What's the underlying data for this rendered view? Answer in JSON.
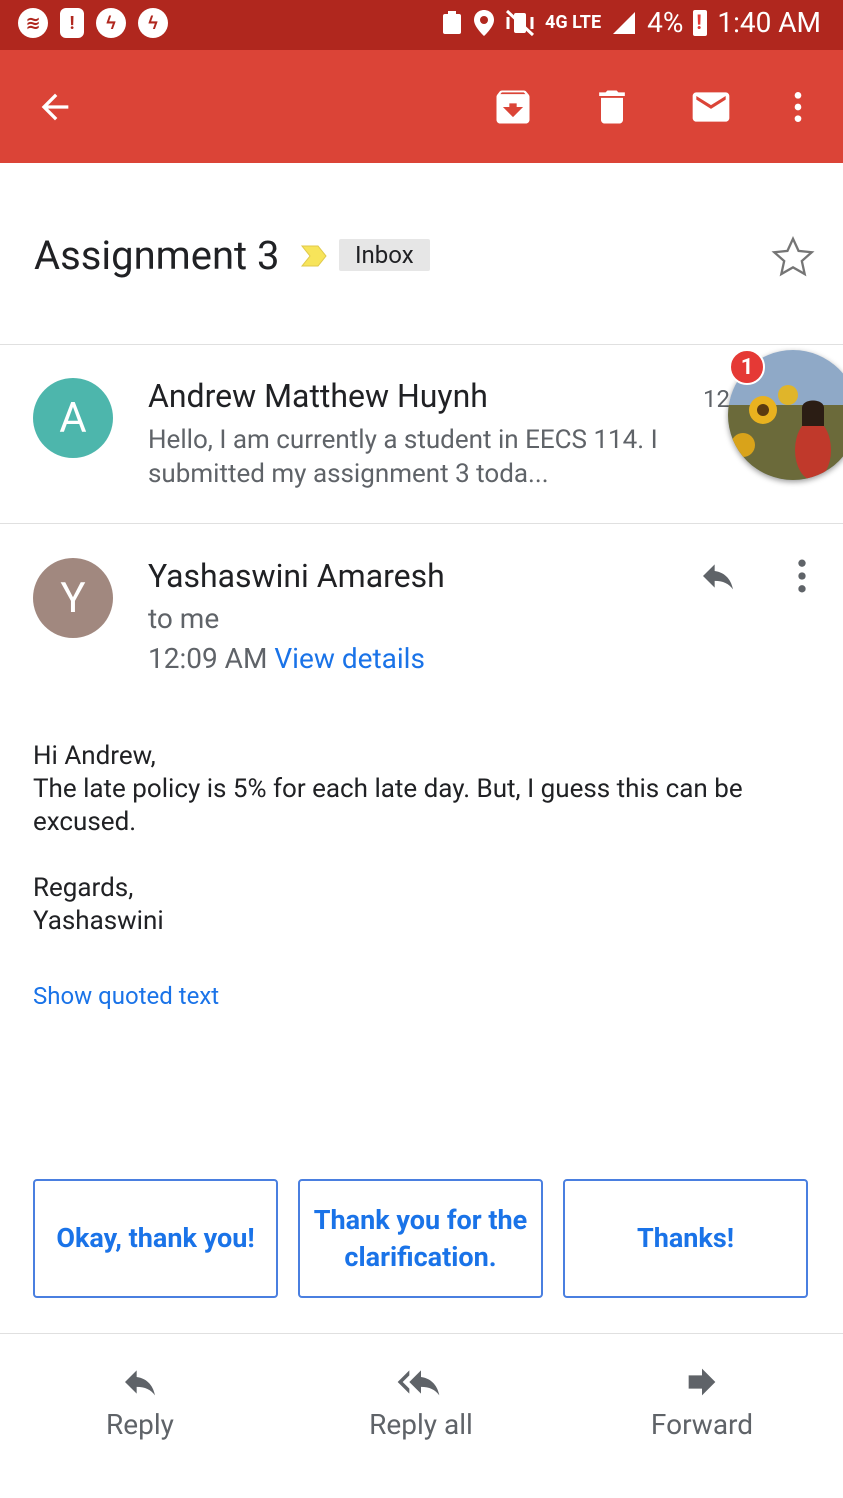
{
  "status_bar": {
    "time": "1:40 AM",
    "battery": "4%",
    "network": "4G LTE"
  },
  "app_bar": {
    "back_icon": "arrow-back-icon",
    "archive_icon": "archive-icon",
    "delete_icon": "delete-icon",
    "mark_unread_icon": "mail-icon",
    "more_icon": "more-vert-icon"
  },
  "thread": {
    "subject": "Assignment 3",
    "label": "Inbox"
  },
  "collapsed_message": {
    "avatar_letter": "A",
    "avatar_color": "#4db6ac",
    "sender": "Andrew Matthew Huynh",
    "time": "12",
    "snippet": "Hello, I am currently a student in EECS 114. I submitted my assignment 3 toda..."
  },
  "chat_head": {
    "badge_count": "1"
  },
  "expanded_message": {
    "avatar_letter": "Y",
    "avatar_color": "#a1887f",
    "sender": "Yashaswini Amaresh",
    "recipient": "to me",
    "time": "12:09 AM",
    "view_details": "View details",
    "body": {
      "greeting": "Hi Andrew,",
      "line1": "The late policy is 5% for each late day. But, I guess this can be excused.",
      "signoff": "Regards,",
      "signature": "Yashaswini"
    },
    "show_quoted": "Show quoted text"
  },
  "smart_replies": [
    {
      "label": "Okay, thank you!"
    },
    {
      "label": "Thank you for the clarification."
    },
    {
      "label": "Thanks!"
    }
  ],
  "actions": {
    "reply": "Reply",
    "reply_all": "Reply all",
    "forward": "Forward"
  },
  "colors": {
    "app_bar": "#db4437",
    "status_bar": "#b0271e",
    "link": "#1a73e8"
  }
}
